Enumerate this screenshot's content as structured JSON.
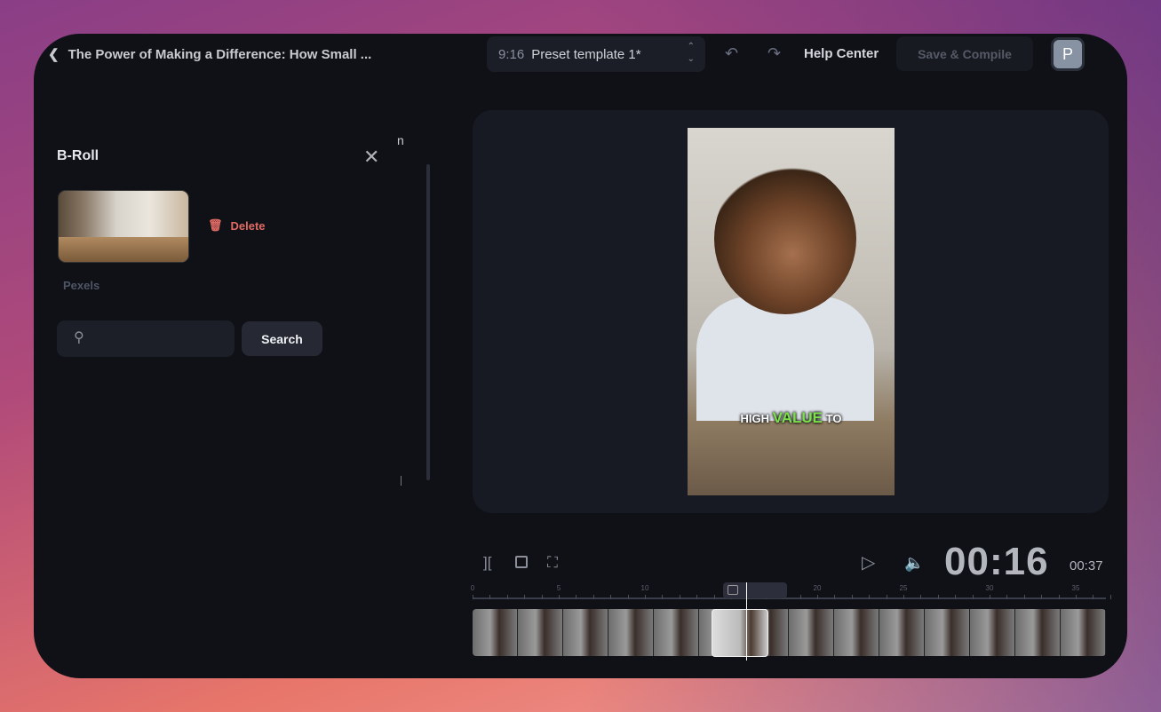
{
  "header": {
    "title": "The Power of Making a Difference: How Small ...",
    "preset_ratio": "9:16",
    "preset_name": "Preset template 1*",
    "help": "Help Center",
    "save": "Save & Compile",
    "avatar": "P"
  },
  "panel": {
    "title": "B-Roll",
    "delete": "Delete",
    "source": "Pexels",
    "search_placeholder": "",
    "search_button": "Search",
    "clipped_text": "n"
  },
  "preview": {
    "caption_pre": "HIGH",
    "caption_hl": "VALUE",
    "caption_post": "TO",
    "caption_color": "#7be04a"
  },
  "player": {
    "current": "00:16",
    "total": "00:37"
  },
  "timeline": {
    "ticks": [
      "0",
      "5",
      "10",
      "20",
      "25",
      "30",
      "35"
    ],
    "tick_seconds": [
      0,
      5,
      10,
      20,
      25,
      30,
      35
    ],
    "duration_s": 37,
    "playhead_s": 16
  }
}
